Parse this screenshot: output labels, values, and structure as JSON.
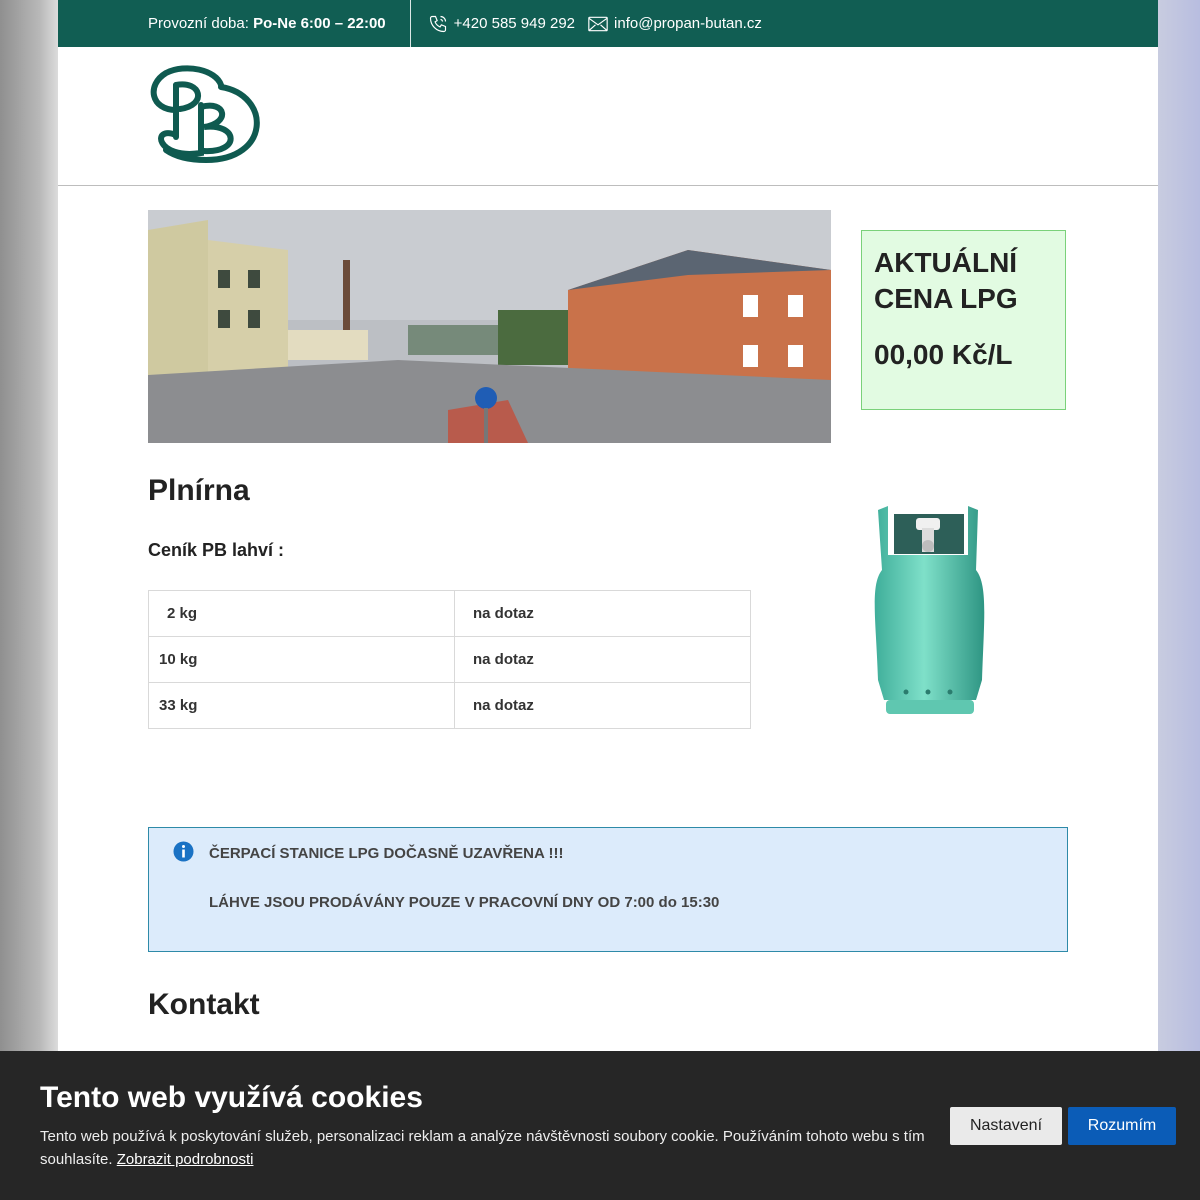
{
  "topbar": {
    "hours_label": "Provozní doba: ",
    "hours_value": "Po-Ne 6:00 – 22:00",
    "phone": "+420 585 949 292",
    "email": "info@propan-butan.cz",
    "bg_color": "#115e53"
  },
  "price_box": {
    "title": "AKTUÁLNÍ CENA LPG",
    "price": "00,00 Kč/L"
  },
  "plnirna": {
    "heading": "Plnírna",
    "subheading": "Ceník PB lahví :",
    "rows": [
      {
        "size": "2 kg",
        "price": "na dotaz"
      },
      {
        "size": "10 kg",
        "price": "na dotaz"
      },
      {
        "size": "33 kg",
        "price": "na dotaz"
      }
    ]
  },
  "alert": {
    "line1": "ČERPACÍ STANICE LPG DOČASNĚ UZAVŘENA !!!",
    "line2": "LÁHVE JSOU PRODÁVÁNY POUZE V PRACOVNÍ DNY OD 7:00 do 15:30",
    "icon": "info-icon"
  },
  "kontakt": {
    "heading": "Kontakt"
  },
  "cookie": {
    "title": "Tento web využívá cookies",
    "text": "Tento web používá k poskytování služeb, personalizaci reklam a analýze návštěvnosti soubory cookie. Používáním tohoto webu s tím souhlasíte. ",
    "link": "Zobrazit podrobnosti",
    "settings_label": "Nastavení",
    "accept_label": "Rozumím",
    "accept_color": "#0b5cb7"
  },
  "icons": [
    "phone-icon",
    "mail-icon",
    "logo-pb",
    "info-icon",
    "gas-bottle-image",
    "street-photo"
  ]
}
